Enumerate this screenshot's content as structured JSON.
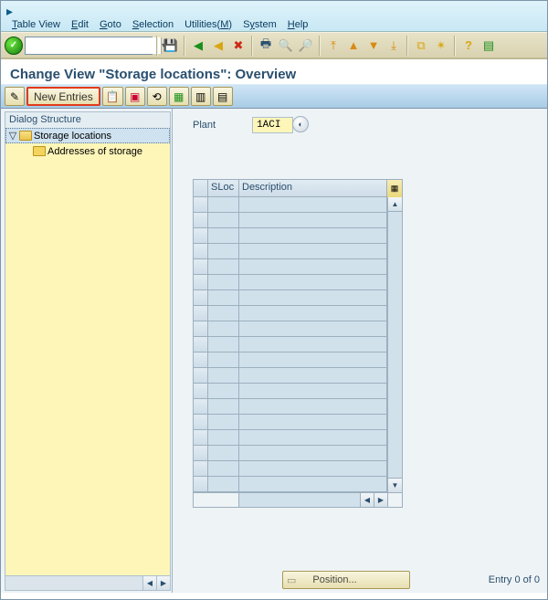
{
  "menu": {
    "session_icon": "▸",
    "items": [
      {
        "pre": "",
        "key": "T",
        "post": "able View"
      },
      {
        "pre": "",
        "key": "E",
        "post": "dit"
      },
      {
        "pre": "",
        "key": "G",
        "post": "oto"
      },
      {
        "pre": "",
        "key": "S",
        "post": "election"
      },
      {
        "pre": "Utilities(",
        "key": "M",
        "post": ")"
      },
      {
        "pre": "S",
        "key": "y",
        "post": "stem"
      },
      {
        "pre": "",
        "key": "H",
        "post": "elp"
      }
    ]
  },
  "title": "Change View \"Storage locations\": Overview",
  "apptoolbar": {
    "new_entries": "New Entries"
  },
  "dialog_structure": {
    "header": "Dialog Structure",
    "root": "Storage locations",
    "child": "Addresses of storage"
  },
  "plant": {
    "label": "Plant",
    "value": "1ACI"
  },
  "grid": {
    "col_sloc": "SLoc",
    "col_desc": "Description",
    "rows": 19
  },
  "footer": {
    "position": "Position...",
    "entry": "Entry 0 of 0"
  }
}
